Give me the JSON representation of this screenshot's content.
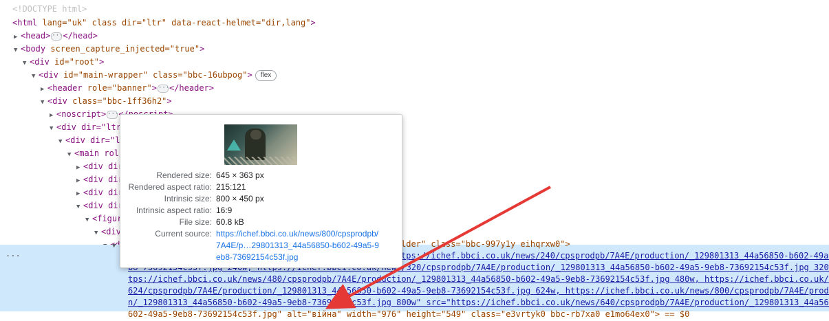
{
  "dom": {
    "doctype": "<!DOCTYPE html>",
    "lines": [
      {
        "tri": "",
        "text_tag": "<html",
        "attrs": " lang=\"uk\" class dir=\"ltr\" data-react-helmet=\"dir,lang\"",
        "close": ">"
      },
      {
        "tri": "▶",
        "text_tag": "<head>",
        "after": "</head>"
      },
      {
        "tri": "▼",
        "text_tag": "<body",
        "attrs": " screen_capture_injected=\"true\"",
        "close": ">"
      },
      {
        "tri": "▼",
        "text_tag": "<div",
        "attrs": " id=\"root\"",
        "close": ">"
      },
      {
        "tri": "▼",
        "text_tag": "<div",
        "attrs": " id=\"main-wrapper\" class=\"bbc-16ubpog\"",
        "close": ">",
        "badge": "flex"
      },
      {
        "tri": "▶",
        "text_tag": "<header",
        "attrs": " role=\"banner\"",
        "close": ">",
        "after": "</header>"
      },
      {
        "tri": "▼",
        "text_tag": "<div",
        "attrs": " class=\"bbc-1ff36h2\"",
        "close": ">"
      },
      {
        "tri": "▶",
        "text_tag": "<noscript>",
        "after": "</noscript>"
      },
      {
        "tri": "▼",
        "text_tag": "<div dir=\"ltr",
        "attrs": "",
        "close": ""
      },
      {
        "tri": "▼",
        "text_tag": "<div dir=\"l",
        "attrs": "",
        "close": ""
      },
      {
        "tri": "▼",
        "text_tag": "<main rol",
        "attrs": "",
        "close": ""
      },
      {
        "tri": "▶",
        "text_tag": "<div dir",
        "attrs": "",
        "close": ""
      },
      {
        "tri": "▶",
        "text_tag": "<div dir",
        "attrs": "",
        "close": ""
      },
      {
        "tri": "▶",
        "text_tag": "<div dir",
        "attrs": "",
        "close": ""
      },
      {
        "tri": "▼",
        "text_tag": "<div dir",
        "attrs": "",
        "close": ""
      },
      {
        "tri": "▼",
        "text_tag": "<figur",
        "attrs": "",
        "close": ""
      },
      {
        "tri": "▼",
        "text_tag": "<div",
        "attrs": "",
        "close": ""
      },
      {
        "tri": "▼",
        "text_tag": "<d",
        "attrs": "",
        "close": ""
      },
      {
        "tri": "▼",
        "text_tag": "",
        "attrs": "",
        "close": ""
      }
    ],
    "selected_lines": [
      "lder\" class=\"bbc-997y1y eihqrxw0\">",
      "tps://ichef.bbci.co.uk/news/240/cpsprodpb/7A4E/production/_129801313_44a56850-b602-49a5-9e",
      "b8-73692154c53f.jpg 240w, https://ichef.bbci.co.uk/news/320/cpsprodpb/7A4E/production/_129801313_44a56850-b602-49a5-9eb8-73692154c53f.jpg 320w, ht",
      "tps://ichef.bbci.co.uk/news/480/cpsprodpb/7A4E/production/_129801313_44a56850-b602-49a5-9eb8-73692154c53f.jpg 480w, https://ichef.bbci.co.uk/news/",
      "624/cpsprodpb/7A4E/production/_129801313_44a56850-b602-49a5-9eb8-73692154c53f.jpg 624w, https://ichef.bbci.co.uk/news/800/cpsprodpb/7A4E/productio",
      "n/_129801313_44a56850-b602-49a5-9eb8-73692154c53f.jpg 800w\" src=\"https://ichef.bbci.co.uk/news/640/cpsprodpb/7A4E/production/_129801313_44a56850-b",
      "602-49a5-9eb8-73692154c53f.jpg\" alt=\"війна\" width=\"976\" height=\"549\" class=\"e3vrtyk0 bbc-rb7xa0 e1mo64ex0\"> == $0"
    ],
    "dots": "..."
  },
  "tooltip": {
    "rows": [
      {
        "label": "Rendered size:",
        "value": "645 × 363 px"
      },
      {
        "label": "Rendered aspect ratio:",
        "value": "215:121"
      },
      {
        "label": "Intrinsic size:",
        "value": "800 × 450 px"
      },
      {
        "label": "Intrinsic aspect ratio:",
        "value": "16:9"
      },
      {
        "label": "File size:",
        "value": "60.8 kB"
      },
      {
        "label": "Current source:",
        "value": "https://ichef.bbci.co.uk/news/800/cpsprodpb/7A4E/p…29801313_44a56850-b602-49a5-9eb8-73692154c53f.jpg"
      }
    ]
  },
  "colors": {
    "selection": "#cfe8fc",
    "tag": "#881280",
    "attr": "#994500",
    "value": "#1a1aa6",
    "arrow": "#e53935"
  },
  "icons": {
    "expand": "triangle-right-icon",
    "collapse": "triangle-down-icon"
  }
}
